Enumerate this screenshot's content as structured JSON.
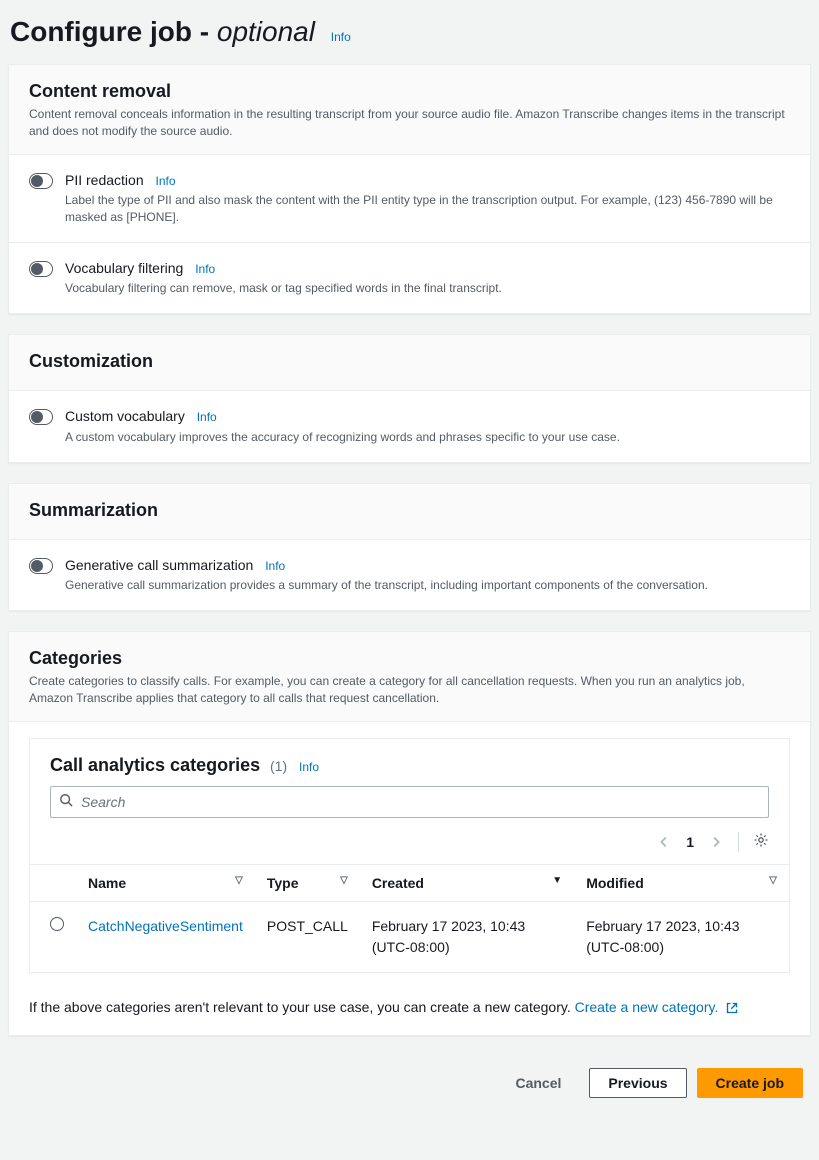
{
  "page": {
    "title_main": "Configure job",
    "title_sep": " - ",
    "title_optional": "optional",
    "info_label": "Info"
  },
  "content_removal": {
    "title": "Content removal",
    "description": "Content removal conceals information in the resulting transcript from your source audio file. Amazon Transcribe changes items in the transcript and does not modify the source audio.",
    "pii": {
      "label": "PII redaction",
      "description": "Label the type of PII and also mask the content with the PII entity type in the transcription output. For example, (123) 456-7890 will be masked as [PHONE]."
    },
    "vocab_filter": {
      "label": "Vocabulary filtering",
      "description": "Vocabulary filtering can remove, mask or tag specified words in the final transcript."
    }
  },
  "customization": {
    "title": "Customization",
    "custom_vocab": {
      "label": "Custom vocabulary",
      "description": "A custom vocabulary improves the accuracy of recognizing words and phrases specific to your use case."
    }
  },
  "summarization": {
    "title": "Summarization",
    "gen_summary": {
      "label": "Generative call summarization",
      "description": "Generative call summarization provides a summary of the transcript, including important components of the conversation."
    }
  },
  "categories": {
    "title": "Categories",
    "description": "Create categories to classify calls. For example, you can create a category for all cancellation requests. When you run an analytics job, Amazon Transcribe applies that category to all calls that request cancellation.",
    "table_title": "Call analytics categories",
    "count": "(1)",
    "search_placeholder": "Search",
    "page_number": "1",
    "columns": {
      "name": "Name",
      "type": "Type",
      "created": "Created",
      "modified": "Modified"
    },
    "rows": [
      {
        "name": "CatchNegativeSentiment",
        "type": "POST_CALL",
        "created": "February 17 2023, 10:43 (UTC-08:00)",
        "modified": "February 17 2023, 10:43 (UTC-08:00)"
      }
    ],
    "footer_text": "If the above categories aren't relevant to your use case, you can create a new category. ",
    "create_link": "Create a new category."
  },
  "actions": {
    "cancel": "Cancel",
    "previous": "Previous",
    "create": "Create job"
  }
}
